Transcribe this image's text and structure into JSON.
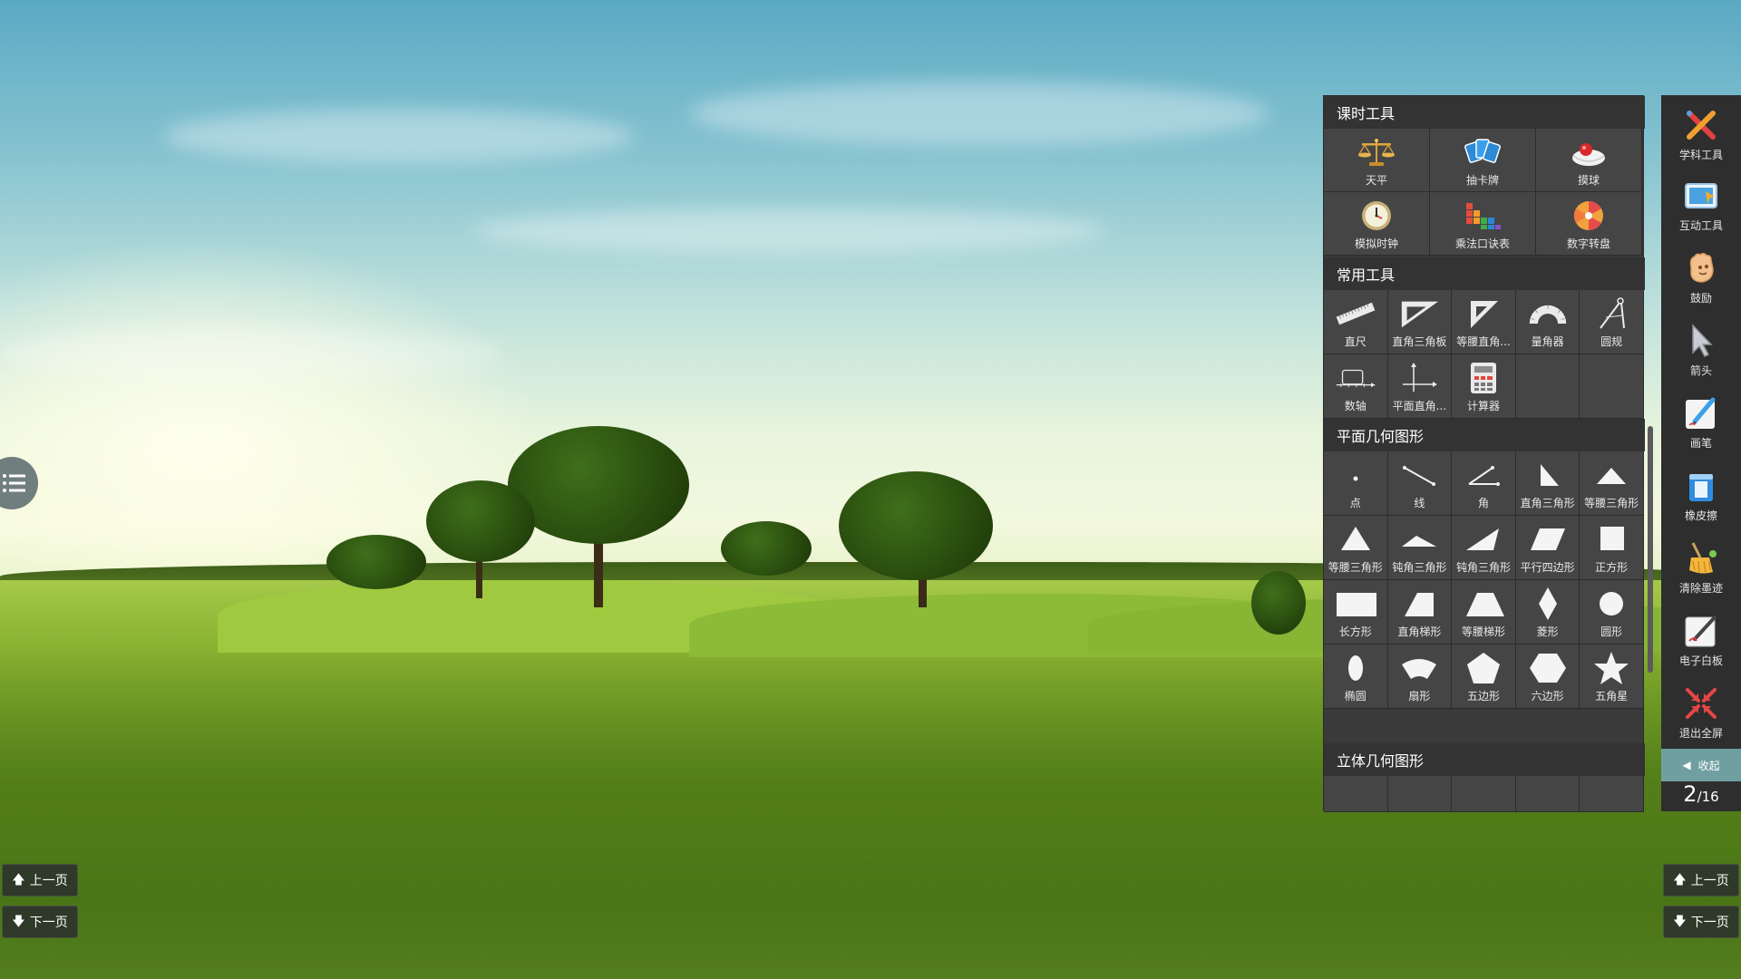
{
  "side_menu": {
    "icon": "list-icon"
  },
  "left_pager": {
    "prev_label": "上一页",
    "next_label": "下一页"
  },
  "right_pager": {
    "prev_label": "上一页",
    "next_label": "下一页"
  },
  "panel": {
    "lesson_tools": {
      "title": "课时工具",
      "items": [
        {
          "label": "天平",
          "icon": "balance-scale-icon"
        },
        {
          "label": "抽卡牌",
          "icon": "cards-icon"
        },
        {
          "label": "摸球",
          "icon": "ball-bag-icon"
        },
        {
          "label": "模拟时钟",
          "icon": "clock-icon"
        },
        {
          "label": "乘法口诀表",
          "icon": "multiplication-table-icon"
        },
        {
          "label": "数字转盘",
          "icon": "number-wheel-icon"
        }
      ]
    },
    "common_tools": {
      "title": "常用工具",
      "items": [
        {
          "label": "直尺",
          "icon": "ruler-icon"
        },
        {
          "label": "直角三角板",
          "icon": "set-square-icon"
        },
        {
          "label": "等腰直角...",
          "icon": "isosceles-set-square-icon"
        },
        {
          "label": "量角器",
          "icon": "protractor-icon"
        },
        {
          "label": "圆规",
          "icon": "compass-icon"
        },
        {
          "label": "数轴",
          "icon": "number-line-icon"
        },
        {
          "label": "平面直角...",
          "icon": "coordinate-axes-icon"
        },
        {
          "label": "计算器",
          "icon": "calculator-icon"
        }
      ]
    },
    "plane_shapes": {
      "title": "平面几何图形",
      "items": [
        {
          "label": "点",
          "icon": "point-icon"
        },
        {
          "label": "线",
          "icon": "line-icon"
        },
        {
          "label": "角",
          "icon": "angle-icon"
        },
        {
          "label": "直角三角形",
          "icon": "right-triangle-icon"
        },
        {
          "label": "等腰三角形",
          "icon": "isosceles-triangle-icon"
        },
        {
          "label": "等腰三角形",
          "icon": "equilateral-triangle-icon"
        },
        {
          "label": "钝角三角形",
          "icon": "obtuse-triangle-icon"
        },
        {
          "label": "钝角三角形",
          "icon": "obtuse-triangle-2-icon"
        },
        {
          "label": "平行四边形",
          "icon": "parallelogram-icon"
        },
        {
          "label": "正方形",
          "icon": "square-icon"
        },
        {
          "label": "长方形",
          "icon": "rectangle-icon"
        },
        {
          "label": "直角梯形",
          "icon": "right-trapezoid-icon"
        },
        {
          "label": "等腰梯形",
          "icon": "isosceles-trapezoid-icon"
        },
        {
          "label": "菱形",
          "icon": "rhombus-icon"
        },
        {
          "label": "圆形",
          "icon": "circle-icon"
        },
        {
          "label": "椭圆",
          "icon": "ellipse-icon"
        },
        {
          "label": "扇形",
          "icon": "sector-icon"
        },
        {
          "label": "五边形",
          "icon": "pentagon-icon"
        },
        {
          "label": "六边形",
          "icon": "hexagon-icon"
        },
        {
          "label": "五角星",
          "icon": "star-icon"
        }
      ]
    },
    "solid_shapes": {
      "title": "立体几何图形"
    }
  },
  "toolbar": {
    "items": [
      {
        "label": "学科工具",
        "icon": "subject-tools-icon"
      },
      {
        "label": "互动工具",
        "icon": "interactive-tools-icon"
      },
      {
        "label": "鼓励",
        "icon": "encourage-hand-icon"
      },
      {
        "label": "箭头",
        "icon": "arrow-cursor-icon"
      },
      {
        "label": "画笔",
        "icon": "pen-icon"
      },
      {
        "label": "橡皮擦",
        "icon": "eraser-icon"
      },
      {
        "label": "清除墨迹",
        "icon": "clear-ink-icon"
      },
      {
        "label": "电子白板",
        "icon": "whiteboard-icon"
      },
      {
        "label": "退出全屏",
        "icon": "exit-fullscreen-icon"
      }
    ],
    "collapse_label": "收起",
    "page_current": "2",
    "page_total": "/16"
  },
  "colors": {
    "panel_bg": "#3a3a3a",
    "toolbar_bg": "#2e2e2e",
    "collapse_bg": "#6f9fa0"
  }
}
